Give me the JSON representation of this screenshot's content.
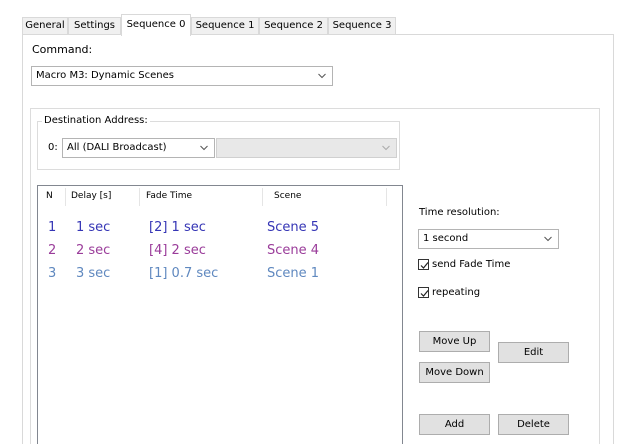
{
  "tabs": [
    {
      "label": "General",
      "active": false
    },
    {
      "label": "Settings",
      "active": false
    },
    {
      "label": "Sequence 0",
      "active": true
    },
    {
      "label": "Sequence 1",
      "active": false
    },
    {
      "label": "Sequence 2",
      "active": false
    },
    {
      "label": "Sequence 3",
      "active": false
    }
  ],
  "command": {
    "label": "Command:",
    "value": "Macro M3: Dynamic Scenes"
  },
  "destination": {
    "title": "Destination Address:",
    "prefix": "0:",
    "value": "All (DALI Broadcast)",
    "secondary_value": ""
  },
  "list": {
    "columns": [
      "N",
      "Delay [s]",
      "Fade Time",
      "Scene"
    ],
    "rows": [
      {
        "n": "1",
        "delay": "1 sec",
        "fade": "[2] 1 sec",
        "scene": "Scene 5",
        "color": "#3535b5"
      },
      {
        "n": "2",
        "delay": "2  sec",
        "fade": "[4]  2 sec",
        "scene": "Scene 4",
        "color": "#9a3c9a"
      },
      {
        "n": "3",
        "delay": "3 sec",
        "fade": "[1]  0.7 sec",
        "scene": "Scene 1",
        "color": "#5f88bf"
      }
    ]
  },
  "options": {
    "time_resolution_label": "Time resolution:",
    "time_resolution_value": "1 second",
    "send_fade_time_label": "send Fade Time",
    "send_fade_time_checked": true,
    "repeating_label": "repeating",
    "repeating_checked": true
  },
  "buttons": {
    "move_up": "Move Up",
    "move_down": "Move Down",
    "edit": "Edit",
    "add": "Add",
    "delete": "Delete"
  },
  "icons": {
    "dropdown": "chevron-down-icon",
    "check": "check-icon"
  }
}
